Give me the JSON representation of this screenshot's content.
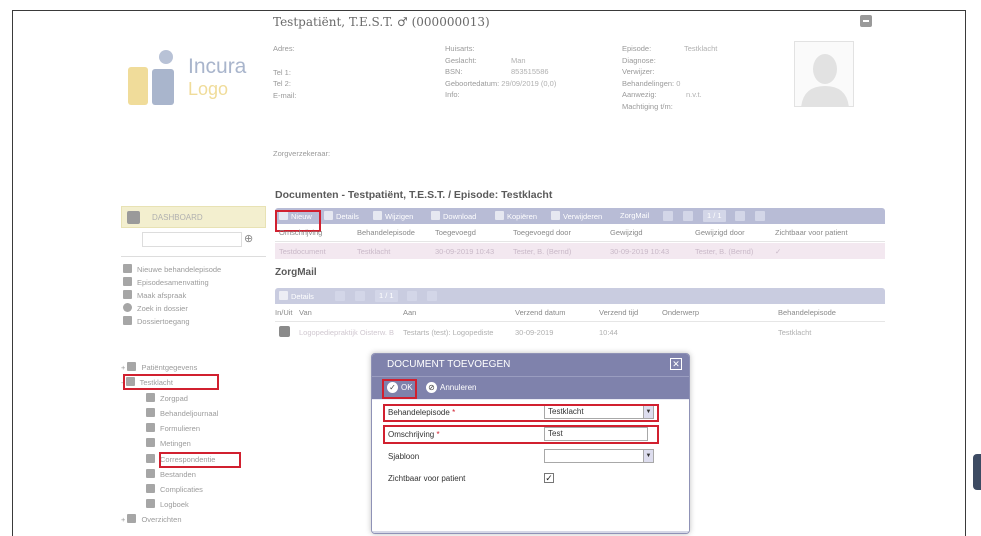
{
  "patient": {
    "title": "Testpatiënt, T.E.S.T. ♂ (000000013)"
  },
  "logo": {
    "line1": "Incura",
    "line2": "Logo"
  },
  "info": {
    "col1": {
      "adres": "Adres:",
      "tel1": "Tel 1:",
      "tel2": "Tel 2:",
      "email": "E-mail:",
      "zorgverzekeraar": "Zorgverzekeraar:"
    },
    "col2": {
      "huisarts": "Huisarts:",
      "geslacht": "Geslacht:",
      "geslacht_val": "Man",
      "bsn": "BSN:",
      "bsn_val": "853515586",
      "geboortedatum": "Geboortedatum:",
      "geboortedatum_val": "29/09/2019 (0,0)",
      "info": "Info:"
    },
    "col3": {
      "episode": "Episode:",
      "episode_val": "Testklacht",
      "diagnose": "Diagnose:",
      "verwijzer": "Verwijzer:",
      "behandelingen": "Behandelingen:",
      "behandelingen_val": "0",
      "aanwezig": "Aanwezig:",
      "aanwezig_val": "n.v.t.",
      "machtiging": "Machtiging t/m:"
    }
  },
  "sidebar": {
    "dashboard": "DASHBOARD",
    "actions": [
      "Nieuwe behandelepisode",
      "Episodesamenvatting",
      "Maak afspraak",
      "Zoek in dossier",
      "Dossiertoegang"
    ],
    "tree": {
      "patientgegevens": "Patiëntgegevens",
      "testklacht": "Testklacht",
      "children": [
        "Zorgpad",
        "Behandeljournaal",
        "Formulieren",
        "Metingen",
        "Correspondentie",
        "Bestanden",
        "Complicaties",
        "Logboek"
      ],
      "overzichten": "Overzichten"
    }
  },
  "documents": {
    "title": "Documenten - Testpatiënt, T.E.S.T. / Episode: Testklacht",
    "toolbar": {
      "nieuw": "Nieuw",
      "details": "Details",
      "wijzigen": "Wijzigen",
      "download": "Download",
      "kopieren": "Kopiëren",
      "verwijderen": "Verwijderen",
      "zorgmail": "ZorgMail",
      "pager": "1 / 1"
    },
    "headers": [
      "Omschrijving",
      "Behandelepisode",
      "Toegevoegd",
      "Toegevoegd door",
      "Gewijzigd",
      "Gewijzigd door",
      "Zichtbaar voor patient"
    ],
    "row": [
      "Testdocument",
      "Testklacht",
      "30-09-2019 10:43",
      "Tester, B. (Bernd)",
      "30-09-2019 10:43",
      "Tester, B. (Bernd)",
      "✓"
    ]
  },
  "zorgmail": {
    "title": "ZorgMail",
    "toolbar": {
      "details": "Details",
      "pager": "1 / 1"
    },
    "headers": [
      "In/Uit",
      "Van",
      "Aan",
      "Verzend datum",
      "Verzend tijd",
      "Onderwerp",
      "Behandelepisode"
    ],
    "row": [
      "Logopediepraktijk Oisterw. B",
      "Testarts (test): Logopediste",
      "30-09-2019",
      "10:44",
      "",
      "Testklacht"
    ]
  },
  "modal": {
    "title": "DOCUMENT TOEVOEGEN",
    "close": "✕",
    "ok": "OK",
    "cancel": "Annuleren",
    "fields": {
      "behandelepisode_label": "Behandelepisode",
      "behandelepisode_value": "Testklacht",
      "omschrijving_label": "Omschrijving",
      "omschrijving_value": "Test",
      "sjabloon_label": "Sjabloon",
      "sjabloon_value": "",
      "zichtbaar_label": "Zichtbaar voor patient",
      "zichtbaar_checked": "✓",
      "required_mark": "*"
    }
  },
  "colors": {
    "accent": "#7f82ac",
    "toolbar": "#b8bcd6",
    "highlight": "#d1202f",
    "dashboard": "#f3efcf"
  }
}
